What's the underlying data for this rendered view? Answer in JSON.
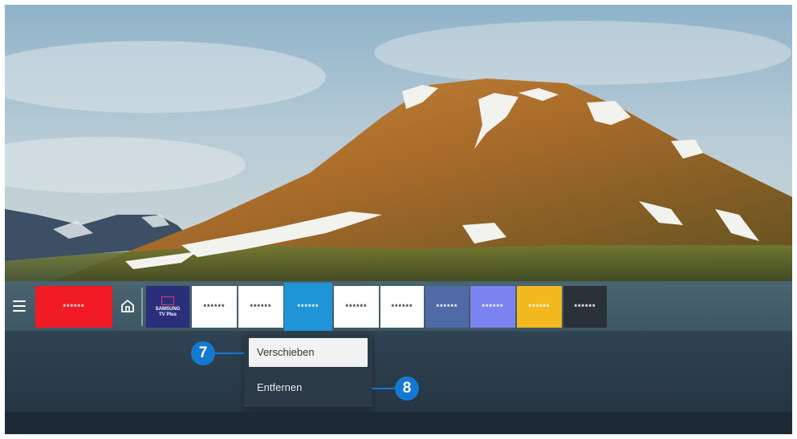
{
  "app_bar": {
    "menu_icon": "hamburger-menu-icon",
    "home_icon": "home-icon",
    "tiles": [
      {
        "label": "******",
        "bg": "#f01b24",
        "fg": "#ffffff"
      },
      {
        "label": "SAMSUNG",
        "sublabel": "TV Plus",
        "bg": "#2a2f7a",
        "fg": "#ffffff"
      },
      {
        "label": "******",
        "bg": "#ffffff",
        "fg": "#333333"
      },
      {
        "label": "******",
        "bg": "#ffffff",
        "fg": "#333333"
      },
      {
        "label": "******",
        "bg": "#1f95d8",
        "fg": "#ffffff"
      },
      {
        "label": "******",
        "bg": "#ffffff",
        "fg": "#333333"
      },
      {
        "label": "******",
        "bg": "#ffffff",
        "fg": "#333333"
      },
      {
        "label": "******",
        "bg": "#4f6aa6",
        "fg": "#ffffff"
      },
      {
        "label": "******",
        "bg": "#7b83f0",
        "fg": "#ffffff"
      },
      {
        "label": "******",
        "bg": "#f3b81e",
        "fg": "#ffffff"
      },
      {
        "label": "******",
        "bg": "#2a3138",
        "fg": "#ffffff"
      }
    ]
  },
  "context_menu": {
    "items": [
      {
        "label": "Verschieben",
        "selected": true
      },
      {
        "label": "Entfernen",
        "selected": false
      }
    ]
  },
  "callouts": [
    {
      "number": "7"
    },
    {
      "number": "8"
    }
  ],
  "colors": {
    "callout": "#1579d1",
    "appbar": "#455f6b"
  }
}
